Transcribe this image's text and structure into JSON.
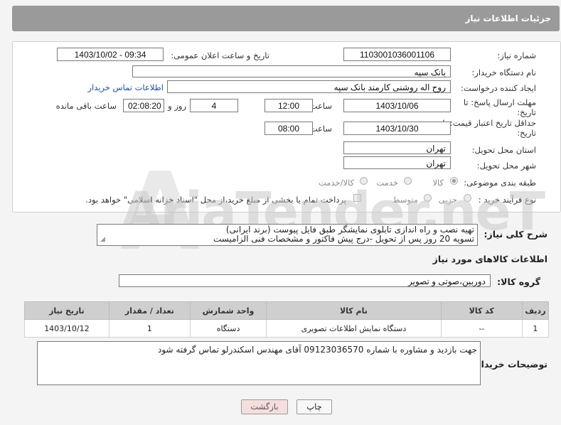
{
  "header": {
    "title": "جزئیات اطلاعات نیاز"
  },
  "fields": {
    "need_number_label": "شماره نیاز:",
    "need_number": "1103001036001106",
    "announce_label": "تاریخ و ساعت اعلان عمومی:",
    "announce_value": "1403/10/02 - 09:34",
    "buyer_org_label": "نام دستگاه خریدار:",
    "buyer_org": "بانک سپه",
    "creator_label": "ایجاد کننده درخواست:",
    "creator": "روح اله روشنی کارمند بانک سپه",
    "buyer_contact_link": "اطلاعات تماس خریدار",
    "reply_deadline_label": "مهلت ارسال پاسخ: تا",
    "reply_deadline_label2": "تاریخ:",
    "reply_date": "1403/10/06",
    "time_label": "ساعت",
    "reply_time": "12:00",
    "days_value": "4",
    "days_label": "روز و",
    "remaining_time": "02:08:20",
    "remaining_label": "ساعت باقی مانده",
    "price_validity_label": "حداقل تاریخ اعتبار قیمت: تا",
    "price_validity_label2": "تاریخ:",
    "price_date": "1403/10/30",
    "price_time": "08:00",
    "province_label": "استان محل تحویل:",
    "province": "تهران",
    "city_label": "شهر محل تحویل:",
    "city": "تهران",
    "category_label": "طبقه بندی موضوعی:",
    "category_options": [
      "کالا",
      "خدمت",
      "کالا/خدمت"
    ],
    "purchase_type_label": "نوع فرآیند خرید :",
    "purchase_options": [
      "جزیی",
      "متوسط"
    ],
    "payment_note": "پرداخت تمام یا بخشی از مبلغ خرید،از محل \"اسناد خزانه اسلامی\" خواهد بود."
  },
  "description": {
    "label": "شرح کلی نیاز:",
    "line1": "تهیه نصب و راه اندازی تابلوی نمایشگر طبق فایل پیوست (برند ایرانی)",
    "line2": "تسویه 20 روز پس از تحویل -درج پیش فاکتور و مشخصات فنی الزامیست"
  },
  "goods_info": {
    "title": "اطلاعات کالاهای مورد نیاز",
    "group_label": "گروه کالا:",
    "group_value": "دوربین،صوتی و تصویر",
    "columns": [
      "ردیف",
      "کد کالا",
      "نام کالا",
      "واحد شمارش",
      "تعداد / مقدار",
      "تاریخ نیاز"
    ],
    "rows": [
      [
        "1",
        "--",
        "دستگاه نمایش اطلاعات تصویری",
        "دستگاه",
        "1",
        "1403/10/12"
      ]
    ]
  },
  "buyer_notes": {
    "label": "توضیحات خریدار:",
    "text": "جهت بازدید و مشاوره با شماره 09123036570 آقای مهندس اسکندرلو تماس گرفته شود"
  },
  "buttons": {
    "print": "چاپ",
    "back": "بازگشت"
  },
  "watermark": {
    "text": "AriaTender.neT"
  },
  "colors": {
    "link": "#1a4fb0",
    "title_bar": "#9a9a9a",
    "back_button": "#f6dede"
  }
}
